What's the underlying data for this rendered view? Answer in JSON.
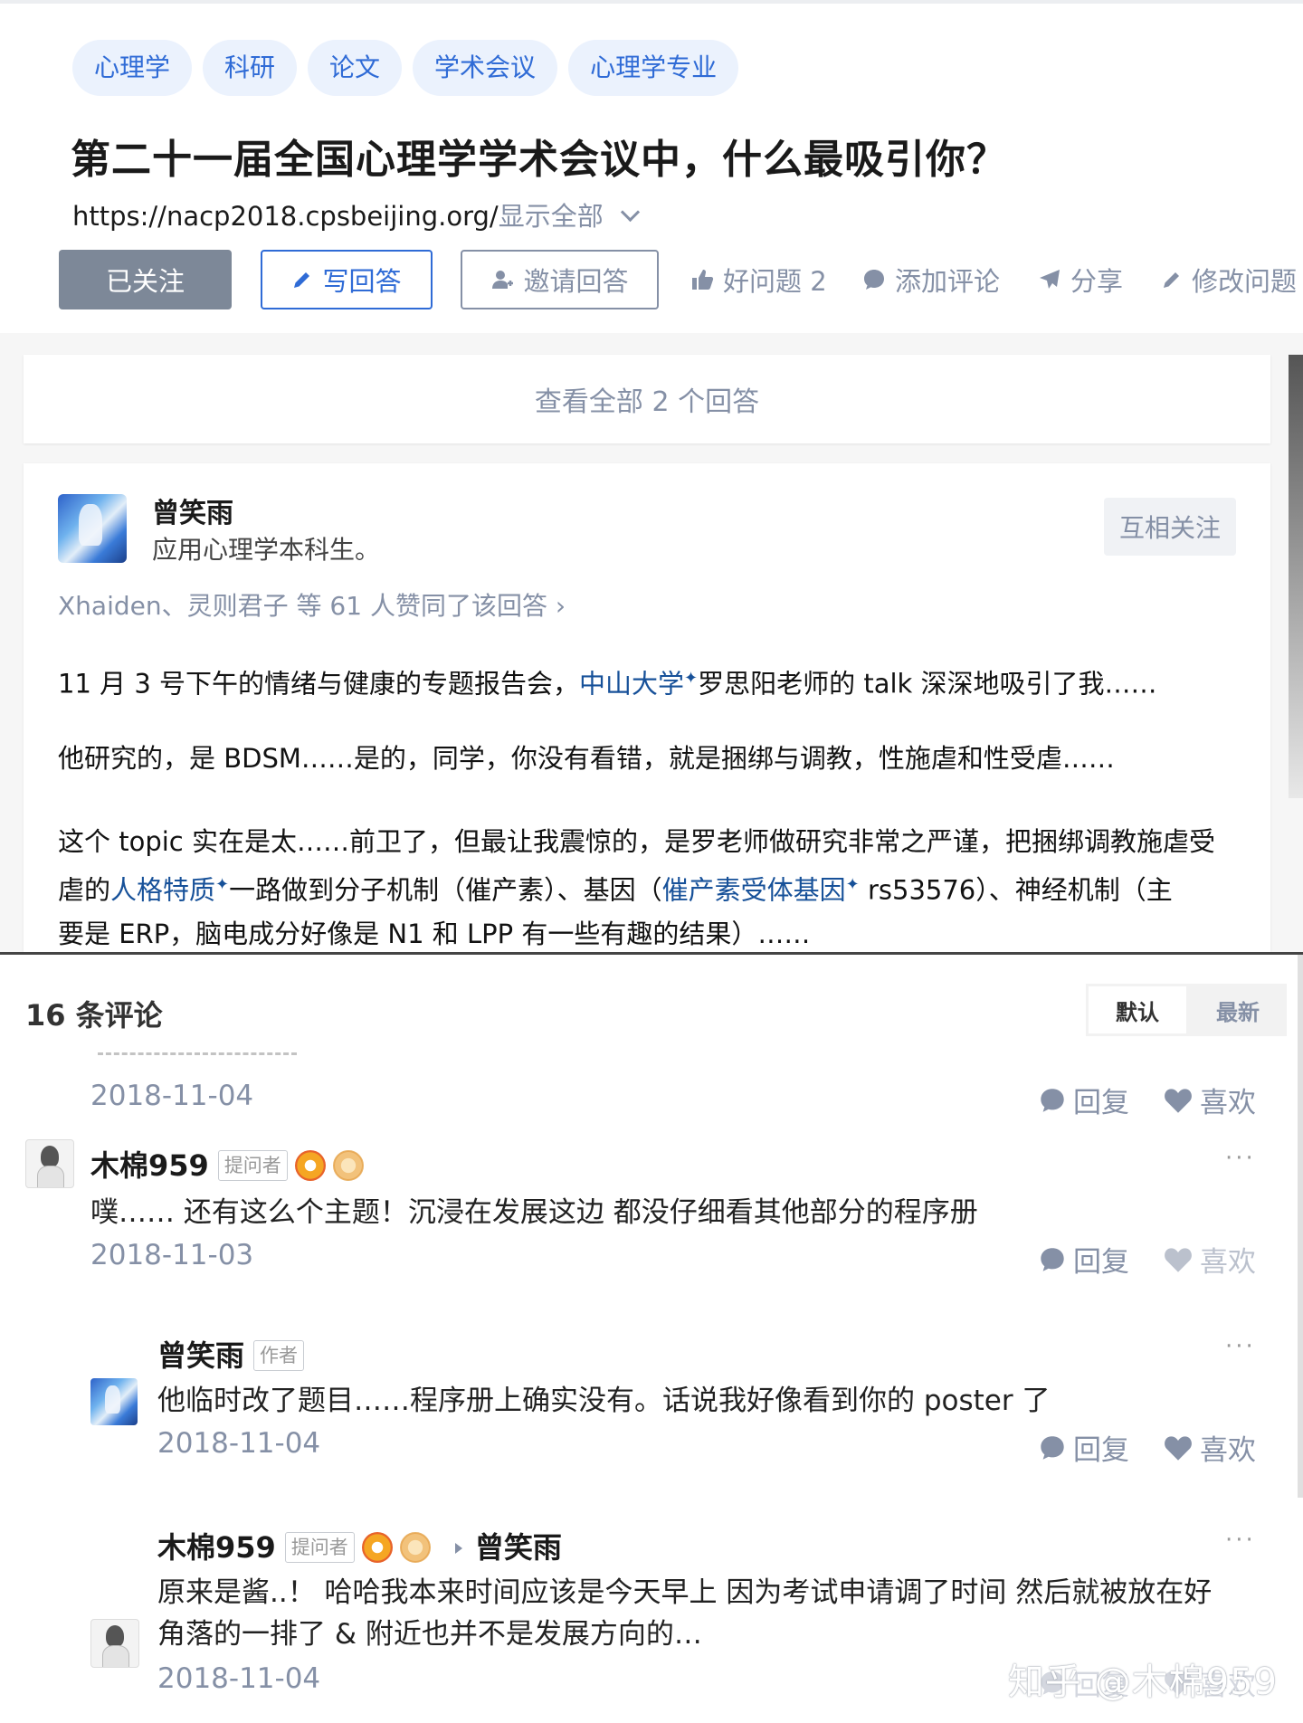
{
  "question": {
    "tags": [
      "心理学",
      "科研",
      "论文",
      "学术会议",
      "心理学专业"
    ],
    "title": "第二十一届全国心理学学术会议中，什么最吸引你？",
    "link": "https://nacp2018.cpsbeijing.org/",
    "show_all": "显示全部",
    "buttons": {
      "followed": "已关注",
      "write": "写回答",
      "invite": "邀请回答",
      "good_question": "好问题 2",
      "add_comment": "添加评论",
      "share": "分享",
      "edit": "修改问题"
    }
  },
  "view_all": "查看全部 2 个回答",
  "answer": {
    "author": "曾笑雨",
    "bio": "应用心理学本科生。",
    "follow_state": "互相关注",
    "voters": "Xhaiden、灵则君子 等 61 人赞同了该回答 ›",
    "p1_a": "11 月 3 号下午的情绪与健康的专题报告会，",
    "p1_link": "中山大学",
    "p1_b": "罗思阳老师的 talk 深深地吸引了我……",
    "p2": "他研究的，是 BDSM……是的，同学，你没有看错，就是捆绑与调教，性施虐和性受虐……",
    "p3_l1": "这个 topic 实在是太……前卫了，但最让我震惊的，是罗老师做研究非常之严谨，把捆绑调教施虐受",
    "p3_l2_a": "虐的",
    "p3_l2_link1": "人格特质",
    "p3_l2_b": "一路做到分子机制（催产素）、基因（",
    "p3_l2_link2": "催产素受体基因",
    "p3_l2_c": " rs53576）、神经机制（主",
    "p3_l3": "要是 ERP，脑电成分好像是 N1 和 LPP 有一些有趣的结果）……",
    "sup_mark": "✦"
  },
  "comments": {
    "title": "16 条评论",
    "sort_default": "默认",
    "sort_latest": "最新",
    "reply_label": "回复",
    "like_label": "喜欢",
    "items": [
      {
        "date": "2018-11-04"
      },
      {
        "user": "木棉959",
        "badge": "提问者",
        "text": "噗…… 还有这么个主题！沉浸在发展这边 都没仔细看其他部分的程序册",
        "date": "2018-11-03"
      },
      {
        "user": "曾笑雨",
        "badge": "作者",
        "text": "他临时改了题目……程序册上确实没有。话说我好像看到你的 poster 了",
        "date": "2018-11-04"
      },
      {
        "user": "木棉959",
        "badge": "提问者",
        "reply_to": "曾笑雨",
        "text_l1": "原来是酱..！ 哈哈我本来时间应该是今天早上 因为考试申请调了时间 然后就被放在好",
        "text_l2": "角落的一排了 & 附近也并不是发展方向的…",
        "date": "2018-11-04"
      }
    ]
  },
  "watermark": "知乎 @木棉959",
  "colors": {
    "accent": "#2f6bd6",
    "muted": "#8590a6",
    "link": "#175199",
    "followed_bg": "#7d8898"
  }
}
